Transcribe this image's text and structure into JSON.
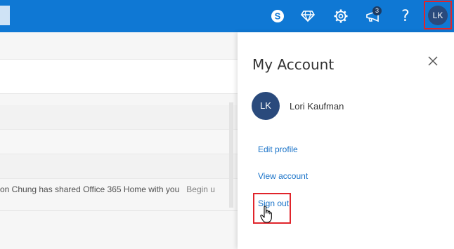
{
  "topbar": {
    "icons": [
      "skype-icon",
      "diamond-icon",
      "gear-icon",
      "megaphone-icon",
      "help-icon"
    ],
    "notification_count": "3",
    "help_glyph": "?",
    "avatar_initials": "LK",
    "colors": {
      "bar": "#0f78d4",
      "highlight": "#e0242b"
    }
  },
  "mail": {
    "share_text": "on Chung has shared Office 365 Home with you",
    "share_action": "Begin u"
  },
  "account_panel": {
    "title": "My Account",
    "avatar_initials": "LK",
    "user_name": "Lori Kaufman",
    "edit_profile": "Edit profile",
    "view_account": "View account",
    "sign_out": "Sign out"
  }
}
